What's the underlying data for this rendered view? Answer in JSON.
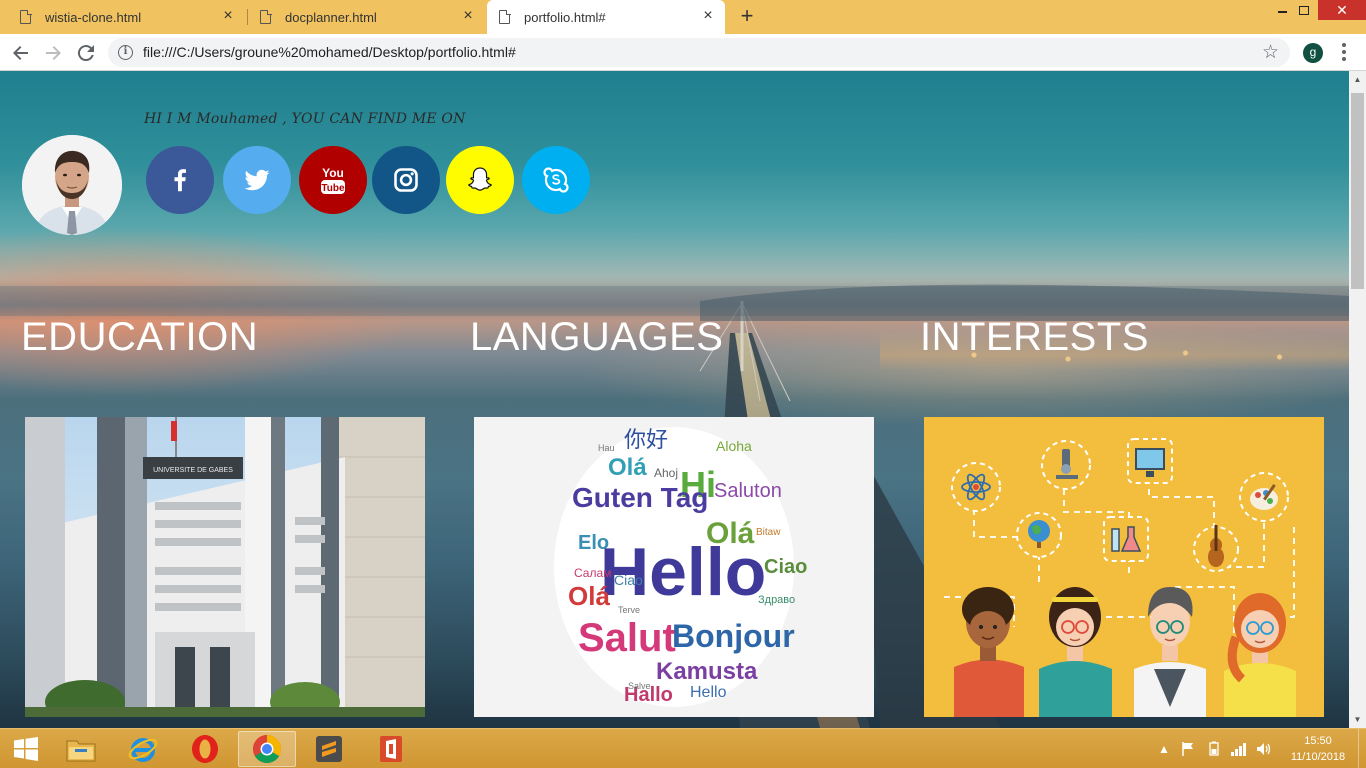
{
  "browser": {
    "tabs": [
      {
        "title": "wistia-clone.html",
        "active": false
      },
      {
        "title": "docplanner.html",
        "active": false
      },
      {
        "title": "portfolio.html#",
        "active": true
      }
    ],
    "url": "file:///C:/Users/groune%20mohamed/Desktop/portfolio.html#",
    "profile_initial": "g",
    "icons": [
      "back-icon",
      "forward-icon",
      "reload-icon",
      "info-icon",
      "star-icon",
      "menu-icon",
      "new-tab-icon",
      "close-icon"
    ]
  },
  "page": {
    "greeting": "HI I M Mouhamed , YOU CAN FIND ME ON",
    "social": [
      {
        "name": "facebook",
        "color": "#3b5998"
      },
      {
        "name": "twitter",
        "color": "#55acee"
      },
      {
        "name": "youtube",
        "color": "#b00000"
      },
      {
        "name": "instagram",
        "color": "#125688"
      },
      {
        "name": "snapchat",
        "color": "#fffc00"
      },
      {
        "name": "skype",
        "color": "#00aff0"
      }
    ],
    "sections": [
      {
        "title": "EDUCATION"
      },
      {
        "title": "LANGUAGES"
      },
      {
        "title": "INTERESTS"
      }
    ],
    "word_cloud": {
      "big": [
        "Hello",
        "Hi",
        "Salut",
        "Bonjour",
        "Guten Tag",
        "Olá",
        "Kamusta",
        "Hallo",
        "Ciao",
        "Elo",
        "Saluton",
        "Aloha"
      ],
      "small": [
        "Ahoj",
        "Здраво",
        "Салам",
        "Terve",
        "Hau",
        "Bitaw",
        "Salve"
      ],
      "cjk": "你好"
    },
    "building_sign": "UNIVERSITE DE GABES"
  },
  "taskbar": {
    "apps": [
      "file-explorer",
      "internet-explorer",
      "opera",
      "chrome",
      "sublime-text",
      "office"
    ],
    "time": "15:50",
    "date": "11/10/2018"
  }
}
